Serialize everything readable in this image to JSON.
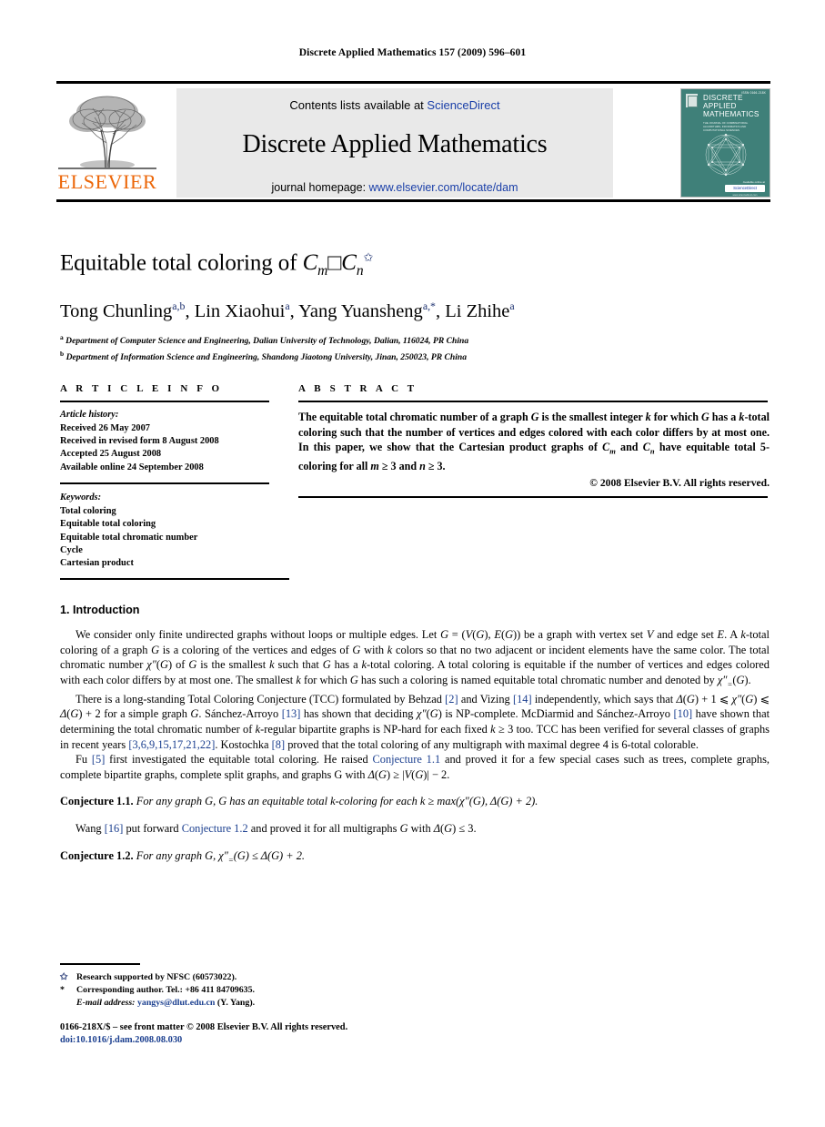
{
  "running_head": "Discrete Applied Mathematics 157 (2009) 596–601",
  "masthead": {
    "contents_prefix": "Contents lists available at ",
    "sciencedirect": "ScienceDirect",
    "journal_title": "Discrete Applied Mathematics",
    "homepage_prefix": "journal homepage: ",
    "homepage_url": "www.elsevier.com/locate/dam",
    "publisher": "ELSEVIER",
    "accent_orange": "#ec6608",
    "link_blue": "#1a3fa8"
  },
  "cover": {
    "issn": "ISSN 0166-218X",
    "title_line1": "DISCRETE",
    "title_line2": "APPLIED",
    "title_line3": "MATHEMATICS",
    "subtitle": "THE JOURNAL OF COMBINATORIAL ALGORITHMS, INFORMATICS AND COMPUTATIONAL SCIENCES",
    "foot_label": "Available online at",
    "badge": "ScienceDirect",
    "badge_sub": "www.sciencedirect.com",
    "background_color": "#3f8079"
  },
  "article": {
    "title_text": "Equitable total coloring of ",
    "title_math_1": "C",
    "title_sub_1": "m",
    "title_box": "□",
    "title_math_2": "C",
    "title_sub_2": "n",
    "title_star": "✩",
    "authors": "Tong Chunling a,b, Lin Xiaohui a, Yang Yuansheng a,*, Li Zhihe a",
    "affiliation_a": "Department of Computer Science and Engineering, Dalian University of Technology, Dalian, 116024, PR China",
    "affiliation_b": "Department of Information Science and Engineering, Shandong Jiaotong University, Jinan, 250023, PR China"
  },
  "article_info": {
    "heading": "A R T I C L E   I N F O",
    "history_label": "Article history:",
    "history": [
      "Received 26 May 2007",
      "Received in revised form 8 August 2008",
      "Accepted 25 August 2008",
      "Available online 24 September 2008"
    ],
    "keywords_label": "Keywords:",
    "keywords": [
      "Total coloring",
      "Equitable total coloring",
      "Equitable total chromatic number",
      "Cycle",
      "Cartesian product"
    ]
  },
  "abstract": {
    "heading": "A B S T R A C T",
    "text": "The equitable total chromatic number of a graph G is the smallest integer k for which G has a k-total coloring such that the number of vertices and edges colored with each color differs by at most one. In this paper, we show that the Cartesian product graphs of Cm and Cn have equitable total 5-coloring for all m ≥ 3 and n ≥ 3.",
    "copyright": "© 2008 Elsevier B.V. All rights reserved."
  },
  "section": {
    "number_and_title": "1.  Introduction",
    "paragraph_1": "We consider only finite undirected graphs without loops or multiple edges. Let G = (V(G), E(G)) be a graph with vertex set V and edge set E. A k-total coloring of a graph G is a coloring of the vertices and edges of G with k colors so that no two adjacent or incident elements have the same color. The total chromatic number χ″(G) of G is the smallest k such that G has a k-total coloring. A total coloring is equitable if the number of vertices and edges colored with each color differs by at most one. The smallest k for which G has such a coloring is named equitable total chromatic number and denoted by χ″=(G).",
    "paragraph_2": "There is a long-standing Total Coloring Conjecture (TCC) formulated by Behzad [2] and Vizing [14] independently, which says that Δ(G) + 1 ⩽ χ″(G) ⩽ Δ(G) + 2 for a simple graph G. Sánchez-Arroyo [13] has shown that deciding χ″(G) is NP-complete. McDiarmid and Sánchez-Arroyo [10] have shown that determining the total chromatic number of k-regular bipartite graphs is NP-hard for each fixed k ≥ 3 too. TCC has been verified for several classes of graphs in recent years [3,6,9,15,17,21,22]. Kostochka [8] proved that the total coloring of any multigraph with maximal degree 4 is 6-total colorable.",
    "paragraph_3": "Fu [5] first investigated the equitable total coloring. He raised Conjecture 1.1 and proved it for a few special cases such as trees, complete graphs, complete bipartite graphs, complete split graphs, and graphs G with Δ(G) ≥ |V(G)| − 2.",
    "paragraph_4": "Wang [16] put forward Conjecture 1.2 and proved it for all multigraphs G with Δ(G) ≤ 3."
  },
  "conjectures": [
    {
      "label": "Conjecture 1.1.",
      "text": "For any graph G, G has an equitable total k-coloring for each k ≥ max(χ″(G), Δ(G) + 2)."
    },
    {
      "label": "Conjecture 1.2.",
      "text": "For any graph G, χ″=(G) ≤ Δ(G) + 2."
    }
  ],
  "footnotes": {
    "star_mark": "✩",
    "star_text": "Research supported by NFSC (60573022).",
    "corr_mark": "*",
    "corr_text": "Corresponding author. Tel.: +86 411 84709635.",
    "email_label": "E-mail address:",
    "email": "yangys@dlut.edu.cn",
    "email_suffix": "(Y. Yang)."
  },
  "imprint": {
    "line1": "0166-218X/$ – see front matter © 2008 Elsevier B.V. All rights reserved.",
    "doi": "doi:10.1016/j.dam.2008.08.030"
  }
}
